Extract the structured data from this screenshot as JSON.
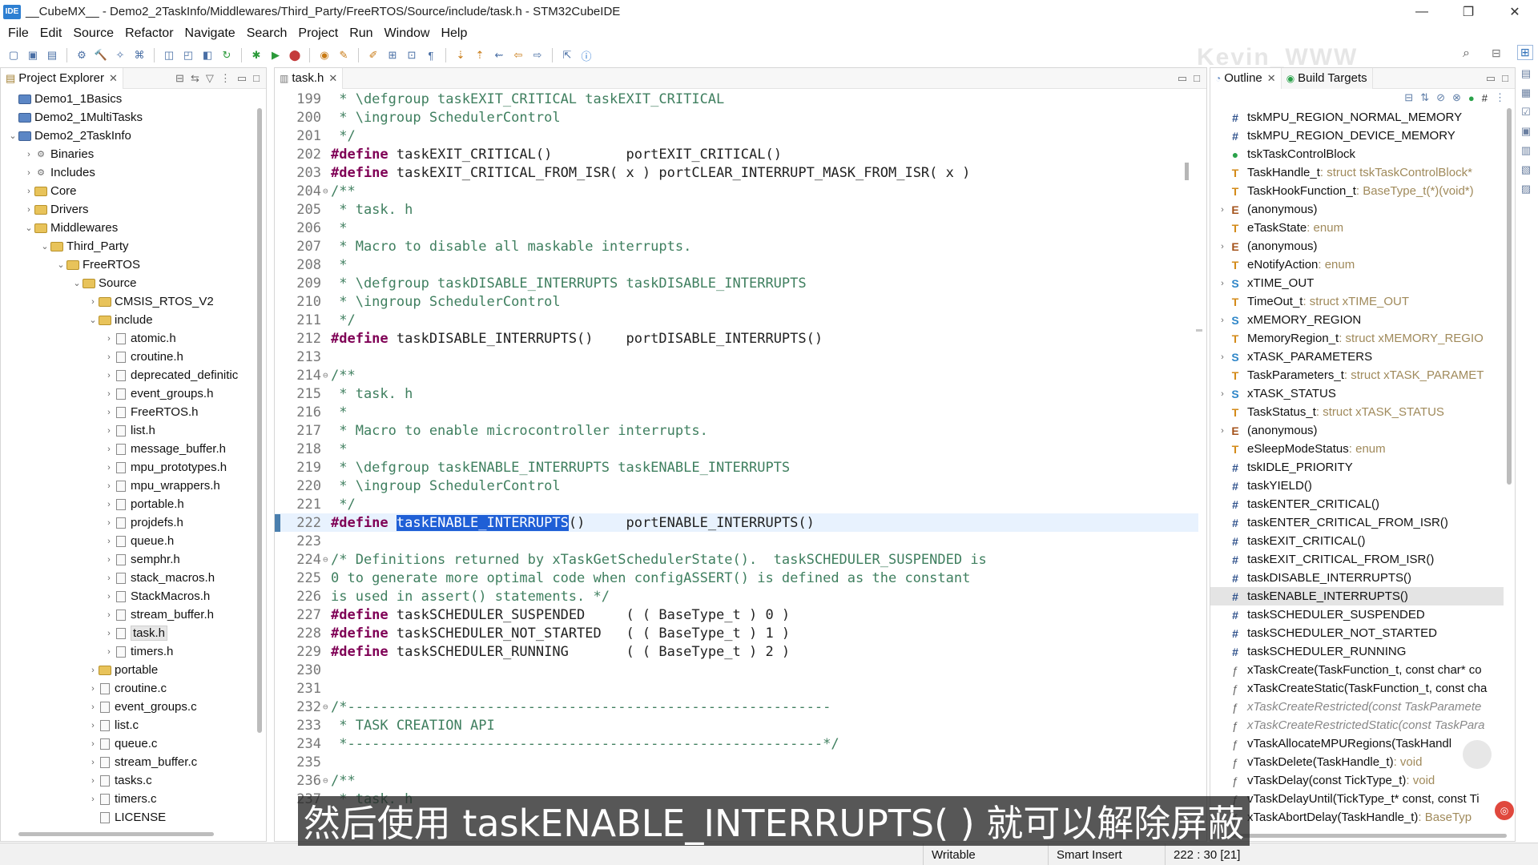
{
  "window": {
    "app_icon_label": "IDE",
    "title": "__CubeMX__ - Demo2_2TaskInfo/Middlewares/Third_Party/FreeRTOS/Source/include/task.h - STM32CubeIDE",
    "controls": {
      "minimize": "—",
      "maximize": "❐",
      "close": "✕"
    }
  },
  "menu": [
    "File",
    "Edit",
    "Source",
    "Refactor",
    "Navigate",
    "Search",
    "Project",
    "Run",
    "Window",
    "Help"
  ],
  "watermark": "Kevin_WWW",
  "project_explorer": {
    "title": "Project Explorer",
    "rows": [
      {
        "label": "Demo1_1Basics",
        "indent": 0,
        "arrow": "",
        "icon": "proj"
      },
      {
        "label": "Demo2_1MultiTasks",
        "indent": 0,
        "arrow": "",
        "icon": "proj"
      },
      {
        "label": "Demo2_2TaskInfo",
        "indent": 0,
        "arrow": "⌄",
        "icon": "proj"
      },
      {
        "label": "Binaries",
        "indent": 1,
        "arrow": "›",
        "icon": "bin"
      },
      {
        "label": "Includes",
        "indent": 1,
        "arrow": "›",
        "icon": "bin"
      },
      {
        "label": "Core",
        "indent": 1,
        "arrow": "›",
        "icon": "folder"
      },
      {
        "label": "Drivers",
        "indent": 1,
        "arrow": "›",
        "icon": "folder"
      },
      {
        "label": "Middlewares",
        "indent": 1,
        "arrow": "⌄",
        "icon": "folder"
      },
      {
        "label": "Third_Party",
        "indent": 2,
        "arrow": "⌄",
        "icon": "folder"
      },
      {
        "label": "FreeRTOS",
        "indent": 3,
        "arrow": "⌄",
        "icon": "folder"
      },
      {
        "label": "Source",
        "indent": 4,
        "arrow": "⌄",
        "icon": "folder"
      },
      {
        "label": "CMSIS_RTOS_V2",
        "indent": 5,
        "arrow": "›",
        "icon": "folder"
      },
      {
        "label": "include",
        "indent": 5,
        "arrow": "⌄",
        "icon": "folder"
      },
      {
        "label": "atomic.h",
        "indent": 6,
        "arrow": "›",
        "icon": "file"
      },
      {
        "label": "croutine.h",
        "indent": 6,
        "arrow": "›",
        "icon": "file"
      },
      {
        "label": "deprecated_definitic",
        "indent": 6,
        "arrow": "›",
        "icon": "file"
      },
      {
        "label": "event_groups.h",
        "indent": 6,
        "arrow": "›",
        "icon": "file"
      },
      {
        "label": "FreeRTOS.h",
        "indent": 6,
        "arrow": "›",
        "icon": "file"
      },
      {
        "label": "list.h",
        "indent": 6,
        "arrow": "›",
        "icon": "file"
      },
      {
        "label": "message_buffer.h",
        "indent": 6,
        "arrow": "›",
        "icon": "file"
      },
      {
        "label": "mpu_prototypes.h",
        "indent": 6,
        "arrow": "›",
        "icon": "file"
      },
      {
        "label": "mpu_wrappers.h",
        "indent": 6,
        "arrow": "›",
        "icon": "file"
      },
      {
        "label": "portable.h",
        "indent": 6,
        "arrow": "›",
        "icon": "file"
      },
      {
        "label": "projdefs.h",
        "indent": 6,
        "arrow": "›",
        "icon": "file"
      },
      {
        "label": "queue.h",
        "indent": 6,
        "arrow": "›",
        "icon": "file"
      },
      {
        "label": "semphr.h",
        "indent": 6,
        "arrow": "›",
        "icon": "file"
      },
      {
        "label": "stack_macros.h",
        "indent": 6,
        "arrow": "›",
        "icon": "file"
      },
      {
        "label": "StackMacros.h",
        "indent": 6,
        "arrow": "›",
        "icon": "file"
      },
      {
        "label": "stream_buffer.h",
        "indent": 6,
        "arrow": "›",
        "icon": "file"
      },
      {
        "label": "task.h",
        "indent": 6,
        "arrow": "›",
        "icon": "file",
        "selected": true
      },
      {
        "label": "timers.h",
        "indent": 6,
        "arrow": "›",
        "icon": "file"
      },
      {
        "label": "portable",
        "indent": 5,
        "arrow": "›",
        "icon": "folder"
      },
      {
        "label": "croutine.c",
        "indent": 5,
        "arrow": "›",
        "icon": "file"
      },
      {
        "label": "event_groups.c",
        "indent": 5,
        "arrow": "›",
        "icon": "file"
      },
      {
        "label": "list.c",
        "indent": 5,
        "arrow": "›",
        "icon": "file"
      },
      {
        "label": "queue.c",
        "indent": 5,
        "arrow": "›",
        "icon": "file"
      },
      {
        "label": "stream_buffer.c",
        "indent": 5,
        "arrow": "›",
        "icon": "file"
      },
      {
        "label": "tasks.c",
        "indent": 5,
        "arrow": "›",
        "icon": "file"
      },
      {
        "label": "timers.c",
        "indent": 5,
        "arrow": "›",
        "icon": "file"
      },
      {
        "label": "LICENSE",
        "indent": 5,
        "arrow": "",
        "icon": "file"
      }
    ]
  },
  "editor": {
    "tab": "task.h",
    "lines": [
      {
        "n": "199",
        "fold": "",
        "segs": [
          {
            "c": "cm",
            "t": " * \\defgroup taskEXIT_CRITICAL taskEXIT_CRITICAL"
          }
        ]
      },
      {
        "n": "200",
        "fold": "",
        "segs": [
          {
            "c": "cm",
            "t": " * \\ingroup SchedulerControl"
          }
        ]
      },
      {
        "n": "201",
        "fold": "",
        "segs": [
          {
            "c": "cm",
            "t": " */"
          }
        ]
      },
      {
        "n": "202",
        "fold": "",
        "segs": [
          {
            "c": "kw",
            "t": "#define"
          },
          {
            "c": "ct",
            "t": " taskEXIT_CRITICAL()         portEXIT_CRITICAL()"
          }
        ]
      },
      {
        "n": "203",
        "fold": "",
        "segs": [
          {
            "c": "kw",
            "t": "#define"
          },
          {
            "c": "ct",
            "t": " taskEXIT_CRITICAL_FROM_ISR( x ) portCLEAR_INTERRUPT_MASK_FROM_ISR( x )"
          }
        ]
      },
      {
        "n": "204",
        "fold": "⊖",
        "segs": [
          {
            "c": "cm",
            "t": "/**"
          }
        ]
      },
      {
        "n": "205",
        "fold": "",
        "segs": [
          {
            "c": "cm",
            "t": " * task. h"
          }
        ]
      },
      {
        "n": "206",
        "fold": "",
        "segs": [
          {
            "c": "cm",
            "t": " *"
          }
        ]
      },
      {
        "n": "207",
        "fold": "",
        "segs": [
          {
            "c": "cm",
            "t": " * Macro to disable all maskable interrupts."
          }
        ]
      },
      {
        "n": "208",
        "fold": "",
        "segs": [
          {
            "c": "cm",
            "t": " *"
          }
        ]
      },
      {
        "n": "209",
        "fold": "",
        "segs": [
          {
            "c": "cm",
            "t": " * \\defgroup taskDISABLE_INTERRUPTS taskDISABLE_INTERRUPTS"
          }
        ]
      },
      {
        "n": "210",
        "fold": "",
        "segs": [
          {
            "c": "cm",
            "t": " * \\ingroup SchedulerControl"
          }
        ]
      },
      {
        "n": "211",
        "fold": "",
        "segs": [
          {
            "c": "cm",
            "t": " */"
          }
        ]
      },
      {
        "n": "212",
        "fold": "",
        "segs": [
          {
            "c": "kw",
            "t": "#define"
          },
          {
            "c": "ct",
            "t": " taskDISABLE_INTERRUPTS()    portDISABLE_INTERRUPTS()"
          }
        ]
      },
      {
        "n": "213",
        "fold": "",
        "segs": []
      },
      {
        "n": "214",
        "fold": "⊖",
        "segs": [
          {
            "c": "cm",
            "t": "/**"
          }
        ]
      },
      {
        "n": "215",
        "fold": "",
        "segs": [
          {
            "c": "cm",
            "t": " * task. h"
          }
        ]
      },
      {
        "n": "216",
        "fold": "",
        "segs": [
          {
            "c": "cm",
            "t": " *"
          }
        ]
      },
      {
        "n": "217",
        "fold": "",
        "segs": [
          {
            "c": "cm",
            "t": " * Macro to enable microcontroller interrupts."
          }
        ]
      },
      {
        "n": "218",
        "fold": "",
        "segs": [
          {
            "c": "cm",
            "t": " *"
          }
        ]
      },
      {
        "n": "219",
        "fold": "",
        "segs": [
          {
            "c": "cm",
            "t": " * \\defgroup taskENABLE_INTERRUPTS taskENABLE_INTERRUPTS"
          }
        ]
      },
      {
        "n": "220",
        "fold": "",
        "segs": [
          {
            "c": "cm",
            "t": " * \\ingroup SchedulerControl"
          }
        ]
      },
      {
        "n": "221",
        "fold": "",
        "segs": [
          {
            "c": "cm",
            "t": " */"
          }
        ]
      },
      {
        "n": "222",
        "fold": "",
        "current": true,
        "segs": [
          {
            "c": "kw",
            "t": "#define"
          },
          {
            "c": "ct",
            "t": " "
          },
          {
            "c": "hl",
            "t": "taskENABLE_INTERRUPTS"
          },
          {
            "c": "ct",
            "t": "()     portENABLE_INTERRUPTS()"
          }
        ]
      },
      {
        "n": "223",
        "fold": "",
        "segs": []
      },
      {
        "n": "224",
        "fold": "⊖",
        "segs": [
          {
            "c": "cm",
            "t": "/* Definitions returned by xTaskGetSchedulerState().  taskSCHEDULER_SUSPENDED is"
          }
        ]
      },
      {
        "n": "225",
        "fold": "",
        "segs": [
          {
            "c": "cm",
            "t": "0 to generate more optimal code when configASSERT() is defined as the constant"
          }
        ]
      },
      {
        "n": "226",
        "fold": "",
        "segs": [
          {
            "c": "cm",
            "t": "is used in assert() statements. */"
          }
        ]
      },
      {
        "n": "227",
        "fold": "",
        "segs": [
          {
            "c": "kw",
            "t": "#define"
          },
          {
            "c": "ct",
            "t": " taskSCHEDULER_SUSPENDED     ( ( BaseType_t ) 0 )"
          }
        ]
      },
      {
        "n": "228",
        "fold": "",
        "segs": [
          {
            "c": "kw",
            "t": "#define"
          },
          {
            "c": "ct",
            "t": " taskSCHEDULER_NOT_STARTED   ( ( BaseType_t ) 1 )"
          }
        ]
      },
      {
        "n": "229",
        "fold": "",
        "segs": [
          {
            "c": "kw",
            "t": "#define"
          },
          {
            "c": "ct",
            "t": " taskSCHEDULER_RUNNING       ( ( BaseType_t ) 2 )"
          }
        ]
      },
      {
        "n": "230",
        "fold": "",
        "segs": []
      },
      {
        "n": "231",
        "fold": "",
        "segs": []
      },
      {
        "n": "232",
        "fold": "⊖",
        "segs": [
          {
            "c": "cm",
            "t": "/*-----------------------------------------------------------"
          }
        ]
      },
      {
        "n": "233",
        "fold": "",
        "segs": [
          {
            "c": "cm",
            "t": " * TASK CREATION API"
          }
        ]
      },
      {
        "n": "234",
        "fold": "",
        "segs": [
          {
            "c": "cm",
            "t": " *----------------------------------------------------------*/"
          }
        ]
      },
      {
        "n": "235",
        "fold": "",
        "segs": []
      },
      {
        "n": "236",
        "fold": "⊖",
        "segs": [
          {
            "c": "cm",
            "t": "/**"
          }
        ]
      },
      {
        "n": "237",
        "fold": "",
        "segs": [
          {
            "c": "cm",
            "t": " * task. h"
          }
        ]
      }
    ]
  },
  "outline": {
    "tabs": [
      "Outline",
      "Build Targets"
    ],
    "rows": [
      {
        "icon": "#",
        "cls": "hash",
        "name": "tskMPU_REGION_NORMAL_MEMORY",
        "type": ""
      },
      {
        "icon": "#",
        "cls": "hash",
        "name": "tskMPU_REGION_DEVICE_MEMORY",
        "type": ""
      },
      {
        "icon": "●",
        "cls": "green",
        "name": "tskTaskControlBlock",
        "type": ""
      },
      {
        "icon": "T",
        "cls": "t",
        "name": "TaskHandle_t",
        "type": " : struct tskTaskControlBlock*"
      },
      {
        "icon": "T",
        "cls": "t",
        "name": "TaskHookFunction_t",
        "type": " : BaseType_t(*)(void*)"
      },
      {
        "icon": "E",
        "cls": "e",
        "name": "(anonymous)",
        "type": "",
        "arrow": "›"
      },
      {
        "icon": "T",
        "cls": "t",
        "name": "eTaskState",
        "type": " : enum"
      },
      {
        "icon": "E",
        "cls": "e",
        "name": "(anonymous)",
        "type": "",
        "arrow": "›"
      },
      {
        "icon": "T",
        "cls": "t",
        "name": "eNotifyAction",
        "type": " : enum"
      },
      {
        "icon": "S",
        "cls": "s",
        "name": "xTIME_OUT",
        "type": "",
        "arrow": "›"
      },
      {
        "icon": "T",
        "cls": "t",
        "name": "TimeOut_t",
        "type": " : struct xTIME_OUT"
      },
      {
        "icon": "S",
        "cls": "s",
        "name": "xMEMORY_REGION",
        "type": "",
        "arrow": "›"
      },
      {
        "icon": "T",
        "cls": "t",
        "name": "MemoryRegion_t",
        "type": " : struct xMEMORY_REGIO"
      },
      {
        "icon": "S",
        "cls": "s",
        "name": "xTASK_PARAMETERS",
        "type": "",
        "arrow": "›"
      },
      {
        "icon": "T",
        "cls": "t",
        "name": "TaskParameters_t",
        "type": " : struct xTASK_PARAMET"
      },
      {
        "icon": "S",
        "cls": "s",
        "name": "xTASK_STATUS",
        "type": "",
        "arrow": "›"
      },
      {
        "icon": "T",
        "cls": "t",
        "name": "TaskStatus_t",
        "type": " : struct xTASK_STATUS"
      },
      {
        "icon": "E",
        "cls": "e",
        "name": "(anonymous)",
        "type": "",
        "arrow": "›"
      },
      {
        "icon": "T",
        "cls": "t",
        "name": "eSleepModeStatus",
        "type": " : enum"
      },
      {
        "icon": "#",
        "cls": "hash",
        "name": "tskIDLE_PRIORITY",
        "type": ""
      },
      {
        "icon": "#",
        "cls": "hash",
        "name": "taskYIELD()",
        "type": ""
      },
      {
        "icon": "#",
        "cls": "hash",
        "name": "taskENTER_CRITICAL()",
        "type": ""
      },
      {
        "icon": "#",
        "cls": "hash",
        "name": "taskENTER_CRITICAL_FROM_ISR()",
        "type": ""
      },
      {
        "icon": "#",
        "cls": "hash",
        "name": "taskEXIT_CRITICAL()",
        "type": ""
      },
      {
        "icon": "#",
        "cls": "hash",
        "name": "taskEXIT_CRITICAL_FROM_ISR()",
        "type": ""
      },
      {
        "icon": "#",
        "cls": "hash",
        "name": "taskDISABLE_INTERRUPTS()",
        "type": ""
      },
      {
        "icon": "#",
        "cls": "hash",
        "name": "taskENABLE_INTERRUPTS()",
        "type": "",
        "selected": true
      },
      {
        "icon": "#",
        "cls": "hash",
        "name": "taskSCHEDULER_SUSPENDED",
        "type": ""
      },
      {
        "icon": "#",
        "cls": "hash",
        "name": "taskSCHEDULER_NOT_STARTED",
        "type": ""
      },
      {
        "icon": "#",
        "cls": "hash",
        "name": "taskSCHEDULER_RUNNING",
        "type": ""
      },
      {
        "icon": "ƒ",
        "cls": "fn",
        "name": "xTaskCreate(TaskFunction_t, const char* co",
        "type": ""
      },
      {
        "icon": "ƒ",
        "cls": "fn",
        "name": "xTaskCreateStatic(TaskFunction_t, const cha",
        "type": ""
      },
      {
        "icon": "ƒ",
        "cls": "fn",
        "name": "xTaskCreateRestricted(const TaskParamete",
        "type": "",
        "gray": true
      },
      {
        "icon": "ƒ",
        "cls": "fn",
        "name": "xTaskCreateRestrictedStatic(const TaskPara",
        "type": "",
        "gray": true
      },
      {
        "icon": "ƒ",
        "cls": "fn",
        "name": "vTaskAllocateMPURegions(TaskHandl",
        "type": ""
      },
      {
        "icon": "ƒ",
        "cls": "fn",
        "name": "vTaskDelete(TaskHandle_t)",
        "type": " : void"
      },
      {
        "icon": "ƒ",
        "cls": "fn",
        "name": "vTaskDelay(const TickType_t)",
        "type": " : void"
      },
      {
        "icon": "ƒ",
        "cls": "fn",
        "name": "vTaskDelayUntil(TickType_t* const, const Ti",
        "type": ""
      },
      {
        "icon": "ƒ",
        "cls": "fn",
        "name": "xTaskAbortDelay(TaskHandle_t)",
        "type": " : BaseTyp"
      }
    ]
  },
  "status": {
    "writable": "Writable",
    "insert_mode": "Smart Insert",
    "position": "222 : 30 [21]"
  },
  "subtitle": "然后使用 taskENABLE_INTERRUPTS( ) 就可以解除屏蔽"
}
